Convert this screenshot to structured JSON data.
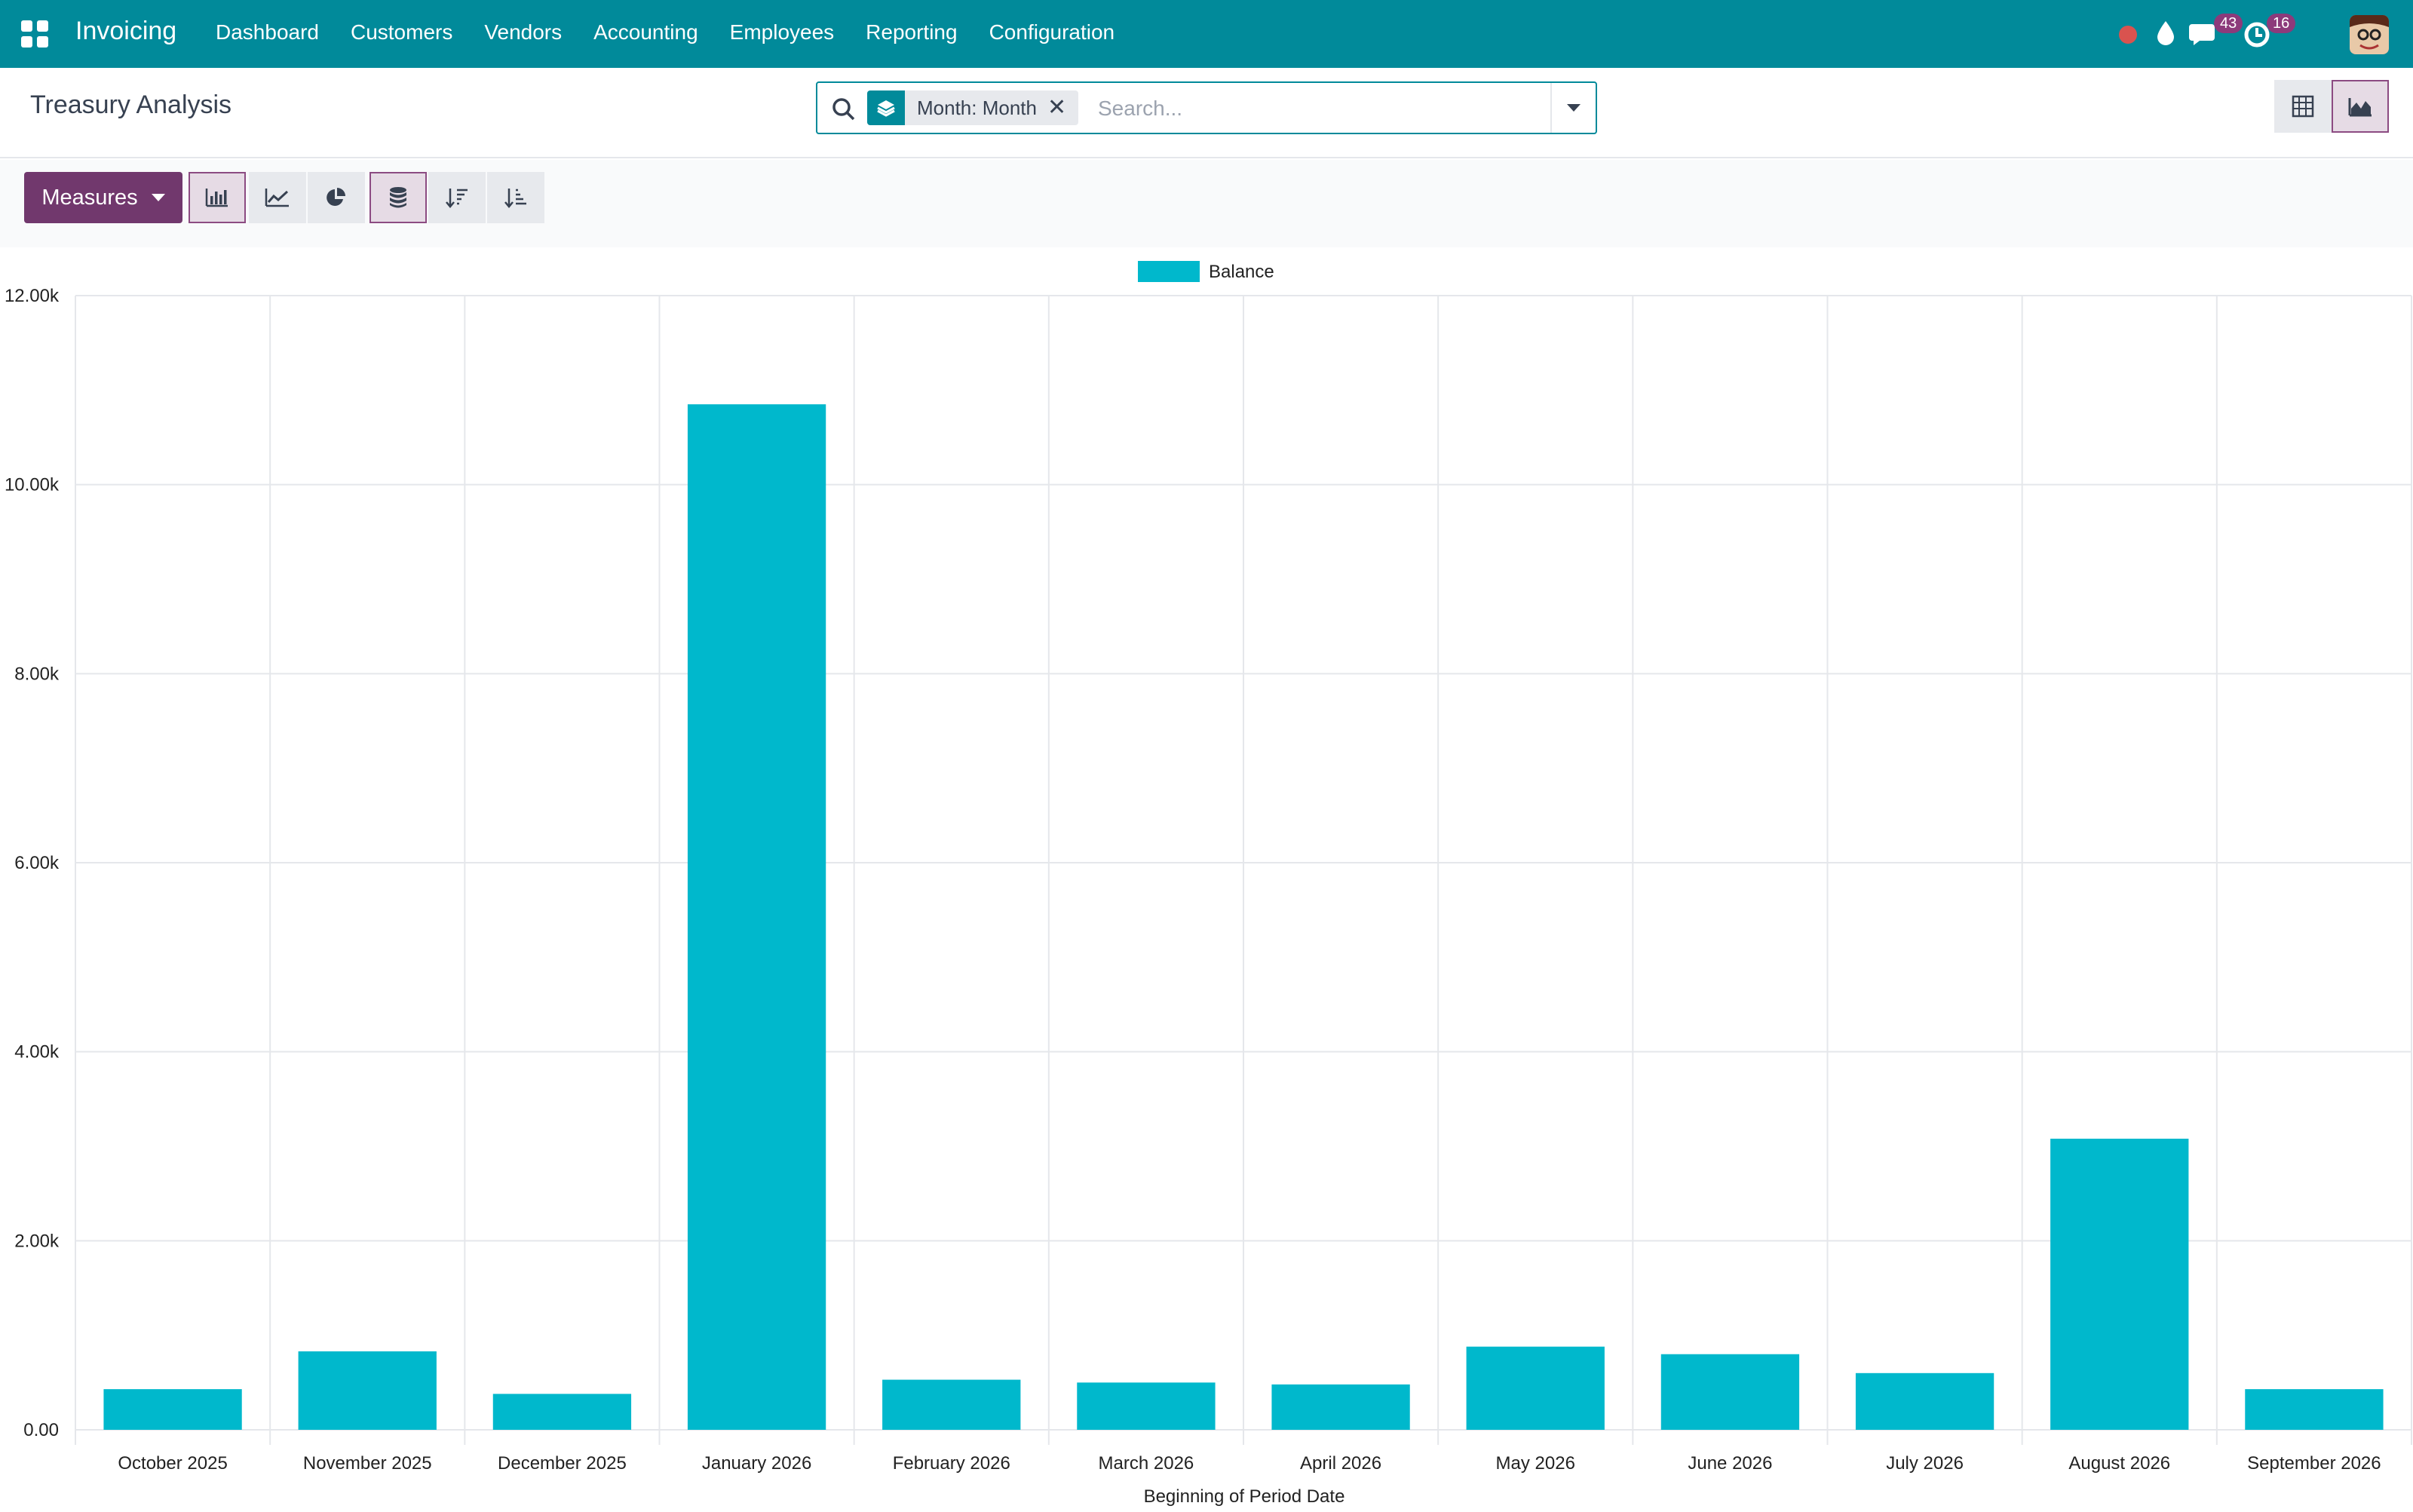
{
  "navbar": {
    "brand": "Invoicing",
    "menu": [
      "Dashboard",
      "Customers",
      "Vendors",
      "Accounting",
      "Employees",
      "Reporting",
      "Configuration"
    ],
    "messages_count": "43",
    "activities_count": "16",
    "colors": {
      "navbar": "#018a9a",
      "badge": "#8c3a7b",
      "record": "#d9534f"
    }
  },
  "control_panel": {
    "breadcrumb": "Treasury Analysis",
    "search": {
      "facet": "Month: Month",
      "placeholder": "Search..."
    }
  },
  "toolbar": {
    "measures_label": "Measures"
  },
  "chart_data": {
    "type": "bar",
    "categories": [
      "October 2025",
      "November 2025",
      "December 2025",
      "January 2026",
      "February 2026",
      "March 2026",
      "April 2026",
      "May 2026",
      "June 2026",
      "July 2026",
      "August 2026",
      "September 2026"
    ],
    "series": [
      {
        "name": "Balance",
        "color": "#00b8cc",
        "values": [
          430,
          830,
          380,
          10850,
          530,
          500,
          480,
          880,
          800,
          600,
          3080,
          430
        ]
      }
    ],
    "xlabel": "Beginning of Period Date",
    "ylabel": "",
    "ylim": [
      0,
      12000
    ],
    "yticks": [
      "0.00",
      "2.00k",
      "4.00k",
      "6.00k",
      "8.00k",
      "10.00k",
      "12.00k"
    ],
    "grid": true,
    "legend": "top-center"
  }
}
